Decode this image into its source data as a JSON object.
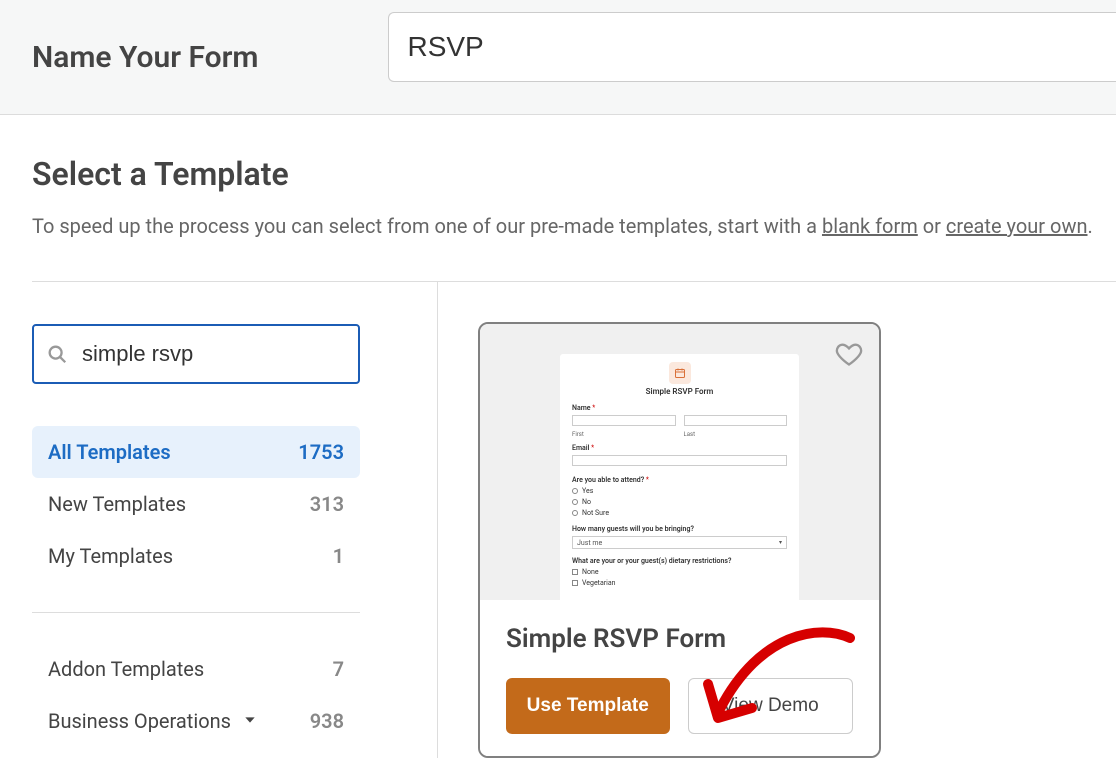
{
  "header": {
    "title": "Name Your Form",
    "form_name_value": "RSVP"
  },
  "section": {
    "title": "Select a Template",
    "subtitle_prefix": "To speed up the process you can select from one of our pre-made templates, start with a ",
    "link_blank": "blank form",
    "subtitle_mid": " or ",
    "link_create": "create your own",
    "subtitle_end": "."
  },
  "search": {
    "value": "simple rsvp"
  },
  "categories_top": [
    {
      "label": "All Templates",
      "count": "1753",
      "active": true
    },
    {
      "label": "New Templates",
      "count": "313",
      "active": false
    },
    {
      "label": "My Templates",
      "count": "1",
      "active": false
    }
  ],
  "categories_bottom": [
    {
      "label": "Addon Templates",
      "count": "7",
      "has_chevron": false
    },
    {
      "label": "Business Operations",
      "count": "938",
      "has_chevron": true
    }
  ],
  "template": {
    "title": "Simple RSVP Form",
    "use_label": "Use Template",
    "demo_label": "View Demo",
    "preview": {
      "heading": "Simple RSVP Form",
      "name_label": "Name",
      "first": "First",
      "last": "Last",
      "email_label": "Email",
      "attend_label": "Are you able to attend?",
      "opt_yes": "Yes",
      "opt_no": "No",
      "opt_notsure": "Not Sure",
      "guests_label": "How many guests will you be bringing?",
      "guests_value": "Just me",
      "dietary_label": "What are your or your guest(s) dietary restrictions?",
      "diet_none": "None",
      "diet_veg": "Vegetarian"
    }
  }
}
